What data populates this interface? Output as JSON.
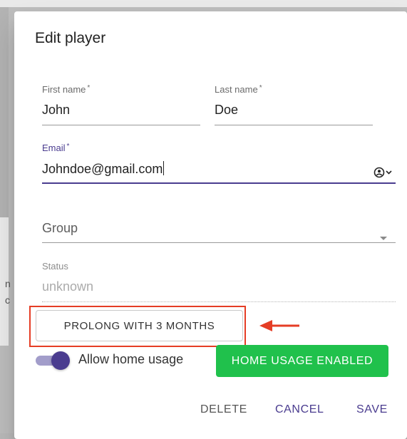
{
  "backdrop": {
    "chars": [
      "n",
      "c"
    ]
  },
  "dialog": {
    "title": "Edit player",
    "fields": {
      "first_name": {
        "label": "First name",
        "required_mark": "*",
        "value": "John"
      },
      "last_name": {
        "label": "Last name",
        "required_mark": "*",
        "value": "Doe"
      },
      "email": {
        "label": "Email",
        "required_mark": "*",
        "value": "Johndoe@gmail.com"
      },
      "group": {
        "placeholder": "Group"
      },
      "status": {
        "label": "Status",
        "value": "unknown"
      }
    },
    "prolong_button": "PROLONG WITH 3 MONTHS",
    "toggle": {
      "label": "Allow home usage",
      "on": true
    },
    "home_usage_badge": "HOME USAGE ENABLED",
    "actions": {
      "delete": "DELETE",
      "cancel": "CANCEL",
      "save": "SAVE"
    }
  },
  "colors": {
    "accent": "#4a3c8f",
    "success": "#20c14c",
    "annotation": "#e53d25"
  },
  "icons": {
    "email_adornment": "account-circle-icon",
    "group_dropdown": "dropdown-arrow-icon",
    "annotation": "arrow-left-icon"
  }
}
